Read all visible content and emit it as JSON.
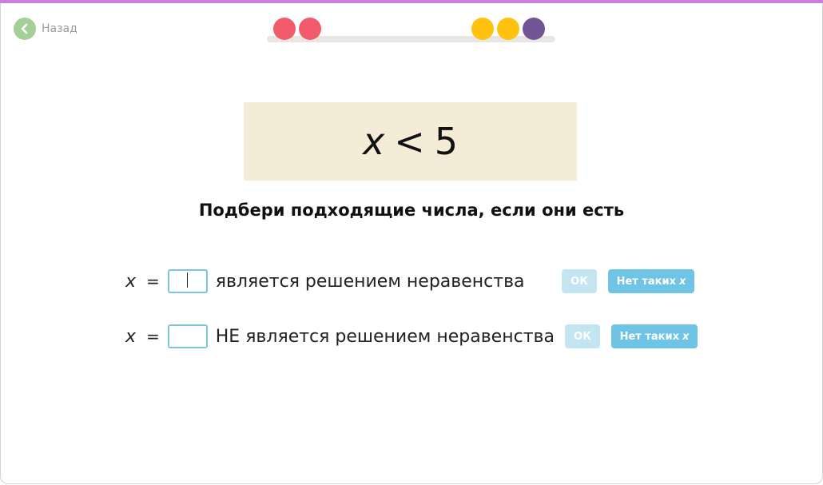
{
  "colors": {
    "top_accent": "#c97fe0",
    "back_button": "#a4cf96",
    "task_background": "#f5ecd7",
    "ok_button_disabled": "#c3e4f1",
    "none_button": "#6ec4e4",
    "input_border": "#7ec4e0"
  },
  "back": {
    "icon": "chevron-left-icon",
    "label": "Назад"
  },
  "progress": {
    "dots": [
      {
        "color": "#f25c6a"
      },
      {
        "color": "#f25c6a"
      },
      {
        "color": "#ffc20e"
      },
      {
        "color": "#ffc20e"
      },
      {
        "color": "#725594"
      }
    ]
  },
  "task": {
    "variable": "x",
    "operator": "<",
    "number": "5"
  },
  "instruction": "Подбери подходящие числа, если они есть",
  "rows": [
    {
      "variable": "x",
      "equals": "=",
      "value": "",
      "description": "является решением неравенства",
      "ok_label": "ОК",
      "none_label": "Нет таких",
      "none_var": "x"
    },
    {
      "variable": "x",
      "equals": "=",
      "value": "",
      "description": "НЕ является решением неравенства",
      "ok_label": "ОК",
      "none_label": "Нет таких",
      "none_var": "x"
    }
  ]
}
